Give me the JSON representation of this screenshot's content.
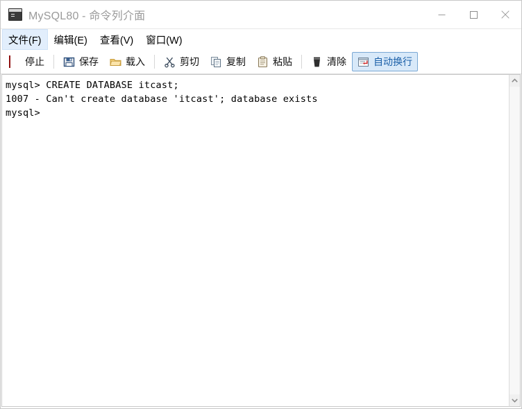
{
  "window": {
    "title": "MySQL80 - 命令列介面",
    "icon": "console-icon",
    "controls": {
      "minimize": "最小化",
      "maximize": "最大化",
      "close": "关闭"
    }
  },
  "menubar": {
    "items": [
      {
        "label": "文件(F)",
        "name": "menu-file",
        "active": true
      },
      {
        "label": "编辑(E)",
        "name": "menu-edit",
        "active": false
      },
      {
        "label": "查看(V)",
        "name": "menu-view",
        "active": false
      },
      {
        "label": "窗口(W)",
        "name": "menu-window",
        "active": false
      }
    ]
  },
  "toolbar": {
    "stop_label": "停止",
    "save_label": "保存",
    "load_label": "载入",
    "cut_label": "剪切",
    "copy_label": "复制",
    "paste_label": "粘贴",
    "clear_label": "清除",
    "wordwrap_label": "自动换行",
    "wordwrap_active": true
  },
  "terminal": {
    "lines": [
      "mysql> CREATE DATABASE itcast;",
      "1007 - Can't create database 'itcast'; database exists",
      "mysql>"
    ],
    "text": "mysql> CREATE DATABASE itcast;\n1007 - Can't create database 'itcast'; database exists\nmysql>"
  },
  "colors": {
    "accent": "#1a5fa8",
    "stop_red": "#e02020",
    "toggle_bg": "#d8e9f9",
    "toggle_border": "#7aa8d4",
    "menu_highlight": "#e2eefc",
    "title_text": "#9a9a9a"
  }
}
